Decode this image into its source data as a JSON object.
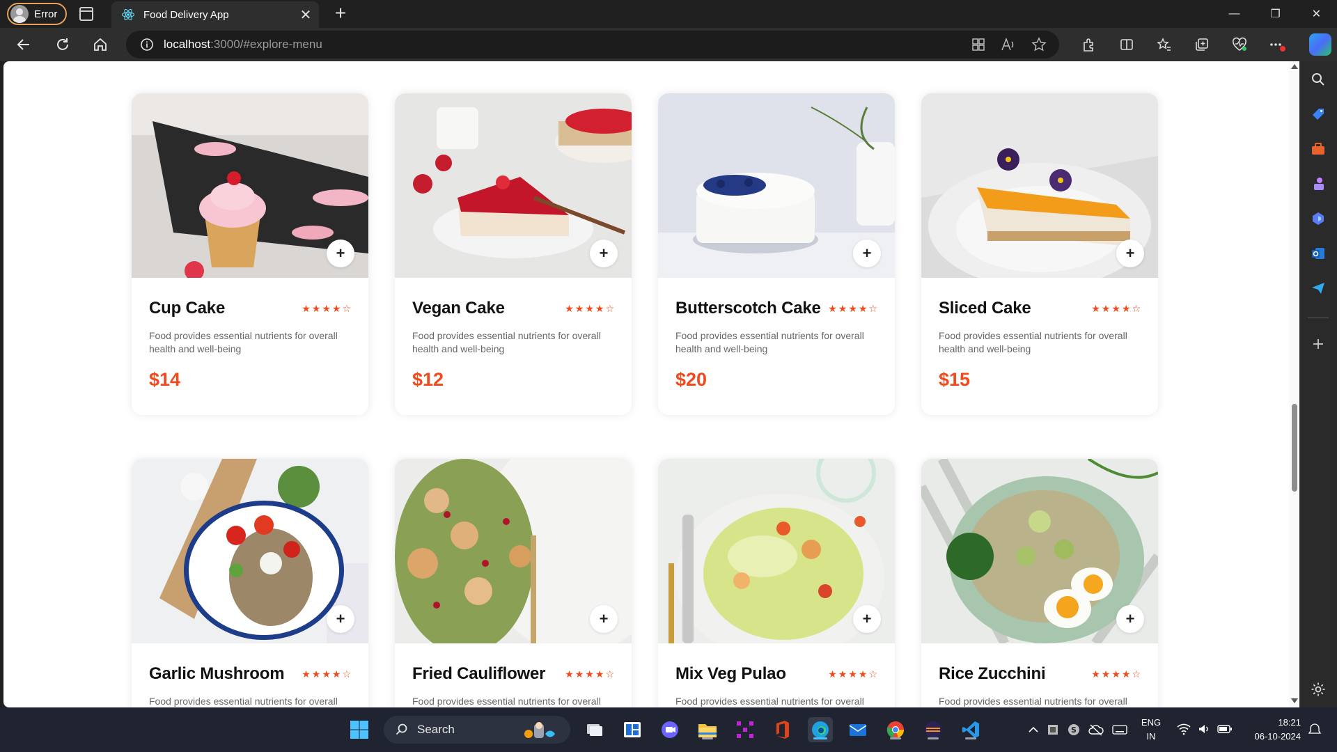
{
  "browser": {
    "profile_label": "Error",
    "tab_title": "Food Delivery App",
    "url_host": "localhost",
    "url_path": ":3000/#explore-menu",
    "accent_color": "#e3a15b"
  },
  "menu": {
    "accent_color": "#f04a1d",
    "rating_stars": [
      "★",
      "★",
      "★",
      "★",
      "☆"
    ],
    "rating_value": 4,
    "rating_max": 5,
    "items": [
      {
        "name": "Cup Cake",
        "description": "Food provides essential nutrients for overall health and well-being",
        "price": "$14",
        "add_symbol": "+"
      },
      {
        "name": "Vegan Cake",
        "description": "Food provides essential nutrients for overall health and well-being",
        "price": "$12",
        "add_symbol": "+"
      },
      {
        "name": "Butterscotch Cake",
        "description": "Food provides essential nutrients for overall health and well-being",
        "price": "$20",
        "add_symbol": "+"
      },
      {
        "name": "Sliced Cake",
        "description": "Food provides essential nutrients for overall health and well-being",
        "price": "$15",
        "add_symbol": "+"
      },
      {
        "name": "Garlic Mushroom",
        "description": "Food provides essential nutrients for overall health and well-being",
        "price": "",
        "add_symbol": "+"
      },
      {
        "name": "Fried Cauliflower",
        "description": "Food provides essential nutrients for overall health and well-being",
        "price": "",
        "add_symbol": "+"
      },
      {
        "name": "Mix Veg Pulao",
        "description": "Food provides essential nutrients for overall health and well-being",
        "price": "",
        "add_symbol": "+"
      },
      {
        "name": "Rice Zucchini",
        "description": "Food provides essential nutrients for overall health and well-being",
        "price": "",
        "add_symbol": "+"
      }
    ]
  },
  "taskbar": {
    "search_label": "Search",
    "lang_primary": "ENG",
    "lang_secondary": "IN",
    "time": "18:21",
    "date": "06-10-2024"
  }
}
